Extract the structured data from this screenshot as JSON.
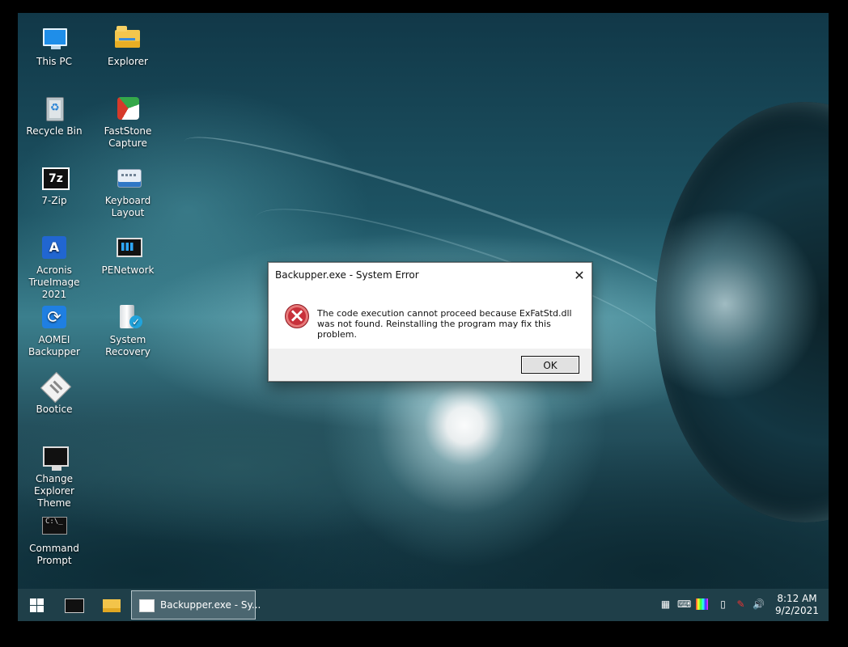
{
  "desktop": {
    "icons": [
      {
        "label": "This PC",
        "icon": "computer-icon"
      },
      {
        "label": "Explorer",
        "icon": "folder-icon"
      },
      {
        "label": "Recycle Bin",
        "icon": "recycle-bin-icon"
      },
      {
        "label": "FastStone Capture",
        "icon": "faststone-capture-icon"
      },
      {
        "label": "7-Zip",
        "icon": "seven-zip-icon"
      },
      {
        "label": "Keyboard Layout",
        "icon": "keyboard-icon"
      },
      {
        "label": "Acronis TrueImage 2021",
        "icon": "acronis-icon"
      },
      {
        "label": "PENetwork",
        "icon": "network-icon"
      },
      {
        "label": "AOMEI Backupper",
        "icon": "aomei-backupper-icon"
      },
      {
        "label": "System Recovery",
        "icon": "system-recovery-icon"
      },
      {
        "label": "Bootice",
        "icon": "bootice-icon"
      },
      {
        "label": "Change Explorer Theme",
        "icon": "monitor-icon"
      },
      {
        "label": "Command Prompt",
        "icon": "command-prompt-icon"
      }
    ]
  },
  "dialog": {
    "title": "Backupper.exe - System Error",
    "close_symbol": "✕",
    "error_symbol": "×",
    "message": "The code execution cannot proceed because ExFatStd.dll was not found. Reinstalling the program may fix this problem.",
    "ok_label": "OK"
  },
  "taskbar": {
    "active_window_label": "Backupper.exe - Sy...",
    "time": "8:12 AM",
    "date": "9/2/2021",
    "icons": [
      "windows-start-icon",
      "command-prompt-icon",
      "file-explorer-icon",
      "backupper-window-icon"
    ],
    "tray_icons": [
      "network-icon",
      "keyboard-icon",
      "color-icon",
      "usb-icon",
      "pen-icon",
      "volume-icon"
    ]
  },
  "colors": {
    "dialog_error_red": "#c8313b",
    "taskbar": "#1f3f49",
    "active_task": "#4b6670"
  }
}
